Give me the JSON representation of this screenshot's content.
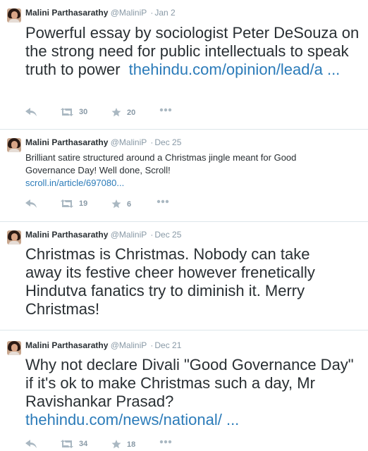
{
  "tweets": [
    {
      "name": "Malini Parthasarathy",
      "handle": "@MaliniP",
      "separator": "·",
      "date": "Jan 2",
      "text": "Powerful essay by sociologist Peter DeSouza on the strong need for public intellectuals to speak truth to power",
      "link": "thehindu.com/opinion/lead/a ...",
      "retweets": "30",
      "favorites": "20"
    },
    {
      "name": "Malini Parthasarathy",
      "handle": "@MaliniP",
      "separator": "·",
      "date": "Dec 25",
      "text": "Brilliant satire structured around a Christmas jingle meant for Good Governance Day! Well done, Scroll!",
      "link": "scroll.in/article/697080...",
      "retweets": "19",
      "favorites": "6"
    },
    {
      "name": "Malini Parthasarathy",
      "handle": "@MaliniP",
      "separator": "·",
      "date": "Dec 25",
      "text": "Christmas is Christmas. Nobody can take away its festive cheer however frenetically Hindutva fanatics try to diminish it. Merry Christmas!"
    },
    {
      "name": "Malini Parthasarathy",
      "handle": "@MaliniP",
      "separator": "·",
      "date": "Dec 21",
      "text": "Why not declare Divali \"Good Governance Day\" if it's ok to make Christmas such a day, Mr Ravishankar Prasad?",
      "link": "thehindu.com/news/national/ ...",
      "retweets": "34",
      "favorites": "18"
    }
  ],
  "icons": [
    "reply-icon",
    "retweet-icon",
    "favorite-icon",
    "more-icon"
  ],
  "colors": {
    "link": "#2b7bb9",
    "muted": "#8899a6",
    "text": "#292f33",
    "divider": "#dde6ea"
  }
}
